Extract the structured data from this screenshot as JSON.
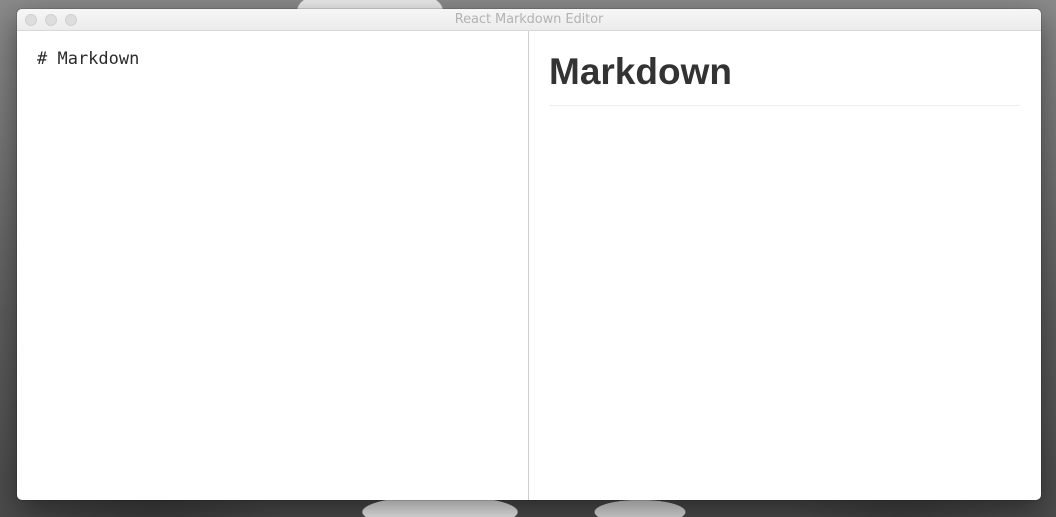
{
  "window": {
    "title": "React Markdown Editor"
  },
  "editor": {
    "text": "# Markdown"
  },
  "preview": {
    "heading": "Markdown"
  }
}
